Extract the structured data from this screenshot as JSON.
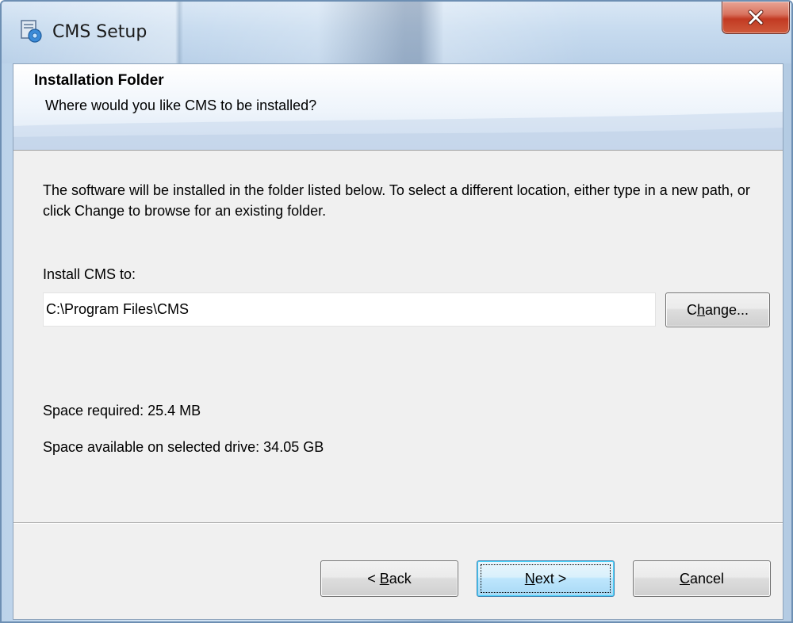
{
  "window": {
    "title": "CMS Setup",
    "icon": "installer-icon",
    "close_icon": "close-icon"
  },
  "banner": {
    "title": "Installation Folder",
    "subtitle": "Where would you like CMS to be installed?"
  },
  "content": {
    "intro": "The software will be installed in the folder listed below. To select a different location, either type in a new path, or click Change to browse for an existing folder.",
    "install_label": "Install CMS to:",
    "install_path": "C:\\Program Files\\CMS",
    "change_prefix": "C",
    "change_mnemonic": "h",
    "change_suffix": "ange...",
    "space_required": "Space required: 25.4 MB",
    "space_available": "Space available on selected drive: 34.05 GB"
  },
  "footer": {
    "back_prefix": "< ",
    "back_mnemonic": "B",
    "back_suffix": "ack",
    "next_mnemonic": "N",
    "next_suffix": "ext >",
    "cancel_mnemonic": "C",
    "cancel_suffix": "ancel"
  },
  "colors": {
    "close_button": "#c23a22",
    "dialog_background": "#f0f0f0",
    "default_button_border": "#3c7fb1"
  }
}
